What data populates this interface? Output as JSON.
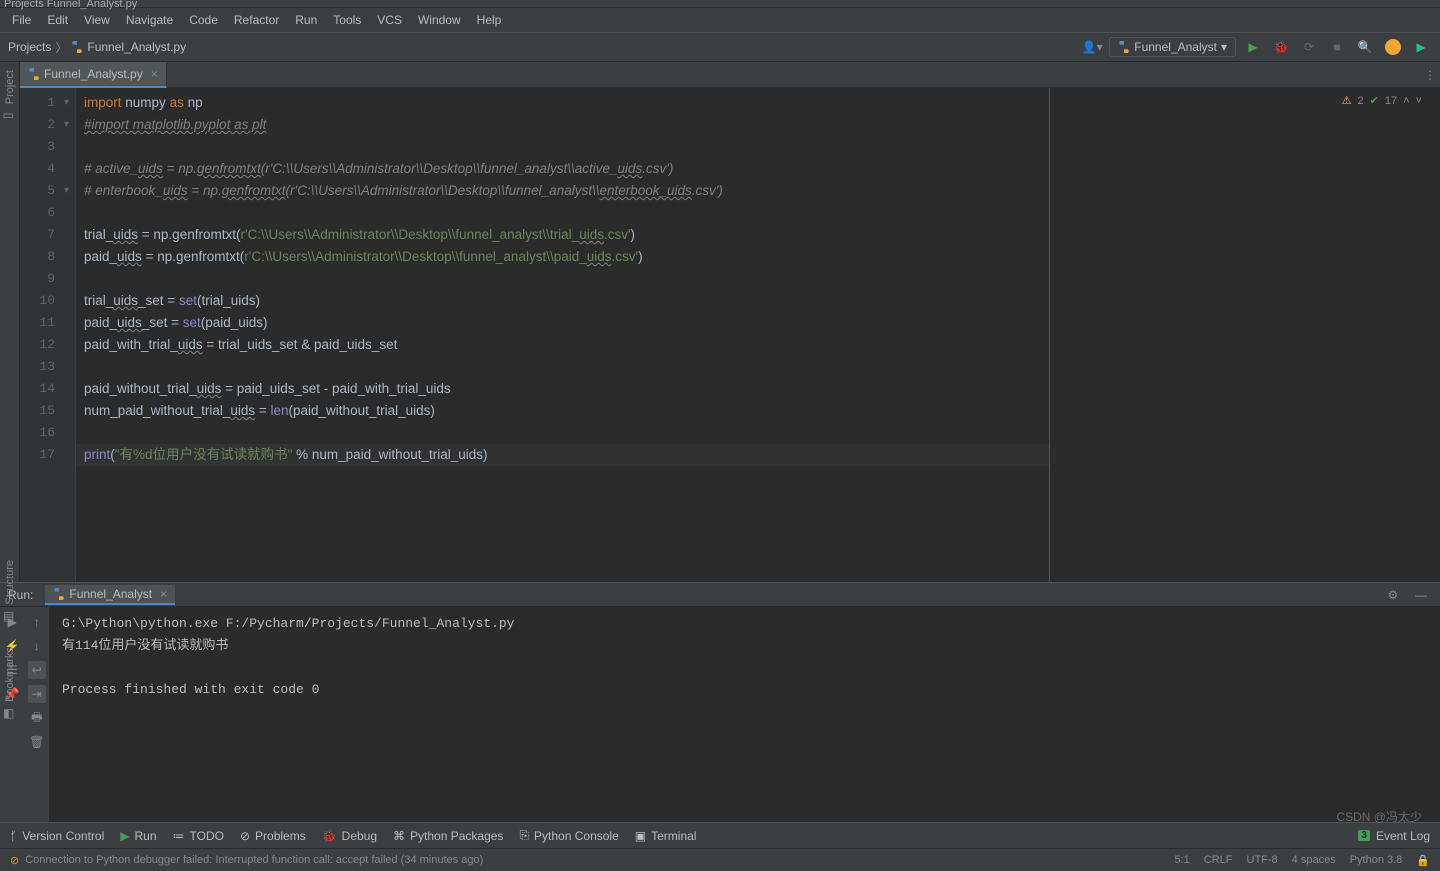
{
  "title_bar": "Projects   Funnel_Analyst.py",
  "menu": {
    "file": "File",
    "edit": "Edit",
    "view": "View",
    "navigate": "Navigate",
    "code": "Code",
    "refactor": "Refactor",
    "run": "Run",
    "tools": "Tools",
    "vcs": "VCS",
    "window": "Window",
    "help": "Help"
  },
  "breadcrumb": {
    "project": "Projects",
    "file": "Funnel_Analyst.py"
  },
  "run_config": {
    "name": "Funnel_Analyst"
  },
  "sidebars": {
    "project": "Project",
    "structure": "Structure",
    "bookmarks": "Bookmarks"
  },
  "file_tab": {
    "name": "Funnel_Analyst.py"
  },
  "inspection": {
    "warnings": "2",
    "typos": "17"
  },
  "code": {
    "lines": [
      {
        "n": "1",
        "html": "<span class='kw'>import</span> <span class='txt'>numpy</span> <span class='kw'>as</span> <span class='txt'>np</span>"
      },
      {
        "n": "2",
        "html": "<span class='cmt waved'>#import matplotlib.pyplot as plt</span>"
      },
      {
        "n": "3",
        "html": ""
      },
      {
        "n": "4",
        "html": "<span class='cmt'># active_<span class='waved'>uids</span> = np.<span class='waved'>genfromtxt</span>(r'C:\\\\Users\\\\Administrator\\\\Desktop\\\\funnel_analyst\\\\active_<span class='waved'>uids</span>.csv')</span>"
      },
      {
        "n": "5",
        "html": "<span class='cmt'># enterbook_<span class='waved'>uids</span> = np.<span class='waved'>genfromtxt</span>(r'C:\\\\Users\\\\Administrator\\\\Desktop\\\\funnel_analyst\\\\<span class='waved'>enterbook_uids</span>.csv')</span>"
      },
      {
        "n": "6",
        "html": ""
      },
      {
        "n": "7",
        "html": "<span class='txt'>trial_<span class='waved'>uids</span> = np.genfromtxt(</span><span class='str'>r'C:\\\\Users\\\\Administrator\\\\Desktop\\\\funnel_analyst\\\\trial_<span class='waved'>uids</span>.csv'</span><span class='txt'>)</span>"
      },
      {
        "n": "8",
        "html": "<span class='txt'>paid_<span class='waved'>uids</span> = np.genfromtxt(</span><span class='str'>r'C:\\\\Users\\\\Administrator\\\\Desktop\\\\funnel_analyst\\\\paid_<span class='waved'>uids</span>.csv'</span><span class='txt'>)</span>"
      },
      {
        "n": "9",
        "html": ""
      },
      {
        "n": "10",
        "html": "<span class='txt'>trial_<span class='waved'>uids</span>_set = </span><span class='builtin'>set</span><span class='txt'>(trial_uids)</span>"
      },
      {
        "n": "11",
        "html": "<span class='txt'>paid_<span class='waved'>uids</span>_set = </span><span class='builtin'>set</span><span class='txt'>(paid_uids)</span>"
      },
      {
        "n": "12",
        "html": "<span class='txt'>paid_with_trial_<span class='waved'>uids</span> = trial_uids_set &amp; paid_uids_set</span>"
      },
      {
        "n": "13",
        "html": ""
      },
      {
        "n": "14",
        "html": "<span class='txt'>paid_without_trial_<span class='waved'>uids</span> = paid_uids_set - paid_with_trial_uids</span>"
      },
      {
        "n": "15",
        "html": "<span class='txt'>num_paid_without_trial_<span class='waved'>uids</span> = </span><span class='builtin'>len</span><span class='txt'>(paid_without_trial_uids)</span>"
      },
      {
        "n": "16",
        "html": ""
      },
      {
        "n": "17",
        "html": "<span class='builtin'>print</span><span class='txt'>(</span><span class='str'>\"有%d位用户没有试读就购书\"</span><span class='txt'> % num_paid_without_trial_uids)</span>",
        "current": true
      }
    ]
  },
  "run": {
    "label": "Run:",
    "tab": "Funnel_Analyst",
    "output": "G:\\Python\\python.exe F:/Pycharm/Projects/Funnel_Analyst.py\n有114位用户没有试读就购书\n\nProcess finished with exit code 0"
  },
  "bottom": {
    "version": "Version Control",
    "run": "Run",
    "todo": "TODO",
    "problems": "Problems",
    "debug": "Debug",
    "packages": "Python Packages",
    "console": "Python Console",
    "terminal": "Terminal",
    "eventlog": "Event Log",
    "evtcount": "3"
  },
  "status": {
    "msg": "Connection to Python debugger failed: Interrupted function call: accept failed (34 minutes ago)",
    "pos": "5:1",
    "crlf": "CRLF",
    "enc": "UTF-8",
    "indent": "4 spaces",
    "python": "Python 3.8"
  },
  "watermark": "CSDN @冯太少"
}
